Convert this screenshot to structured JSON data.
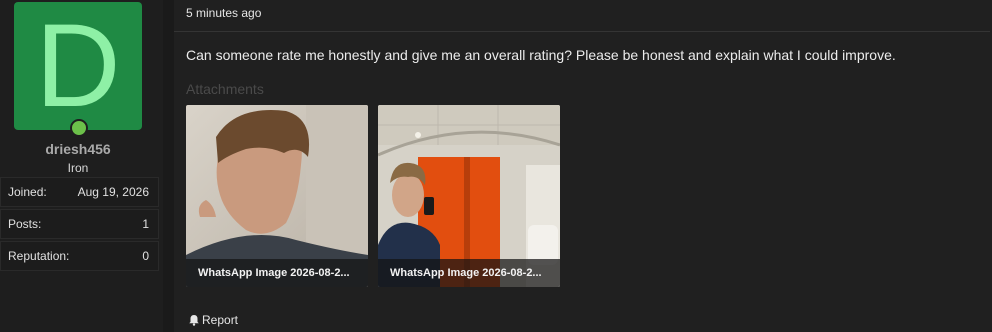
{
  "user": {
    "avatar_letter": "D",
    "username": "driesh456",
    "title": "Iron",
    "avatar_color": "#1f8a44",
    "online_color": "#6cc04a"
  },
  "stats": [
    {
      "label": "Joined:",
      "value": "Aug 19, 2026"
    },
    {
      "label": "Posts:",
      "value": "1"
    },
    {
      "label": "Reputation:",
      "value": "0"
    }
  ],
  "post": {
    "timestamp": "5 minutes ago",
    "message": "Can someone rate me honestly and give me an overall rating? Please be honest and explain what I could improve.",
    "attachments_label": "Attachments",
    "attachments": [
      {
        "caption": "WhatsApp Image 2026-08-2..."
      },
      {
        "caption": "WhatsApp Image 2026-08-2..."
      }
    ],
    "report_label": "Report"
  }
}
